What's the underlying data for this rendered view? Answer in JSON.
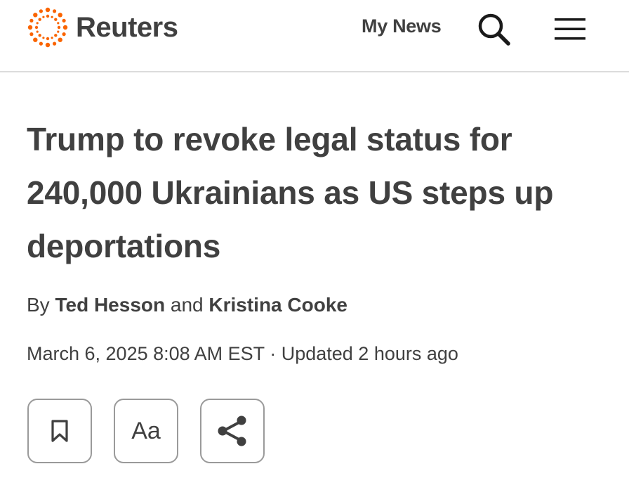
{
  "header": {
    "logo_text": "Reuters",
    "my_news_label": "My News",
    "search_icon": "search-icon",
    "menu_icon": "hamburger-menu-icon",
    "brand_color": "#fa6400"
  },
  "article": {
    "headline": "Trump to revoke legal status for 240,000 Ukrainians as US steps up deportations",
    "byline": {
      "prefix": "By",
      "author1": "Ted Hesson",
      "conjunction": "and",
      "author2": "Kristina Cooke"
    },
    "date": "March 6, 2025 8:08 AM EST",
    "separator": "·",
    "updated": "Updated 2 hours ago"
  },
  "tools": {
    "save_icon": "bookmark-icon",
    "text_size_label": "Aa",
    "share_icon": "share-icon"
  }
}
